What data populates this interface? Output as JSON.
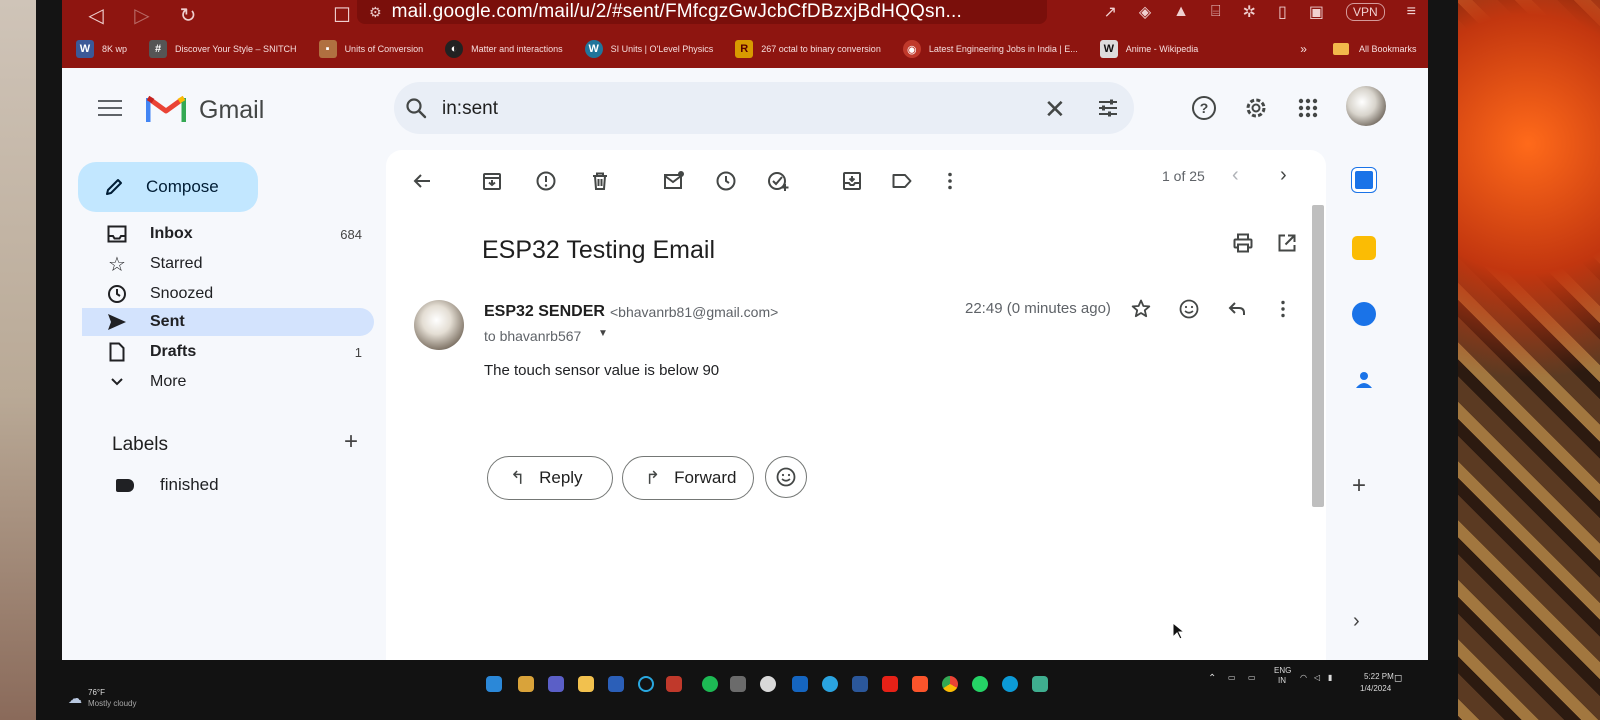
{
  "browser": {
    "url": "mail.google.com/mail/u/2/#sent/FMfcgzGwJcbCfDBzxjBdHQQsn...",
    "vpn_label": "VPN",
    "bookmarks": [
      {
        "icon": "W",
        "label": "8K wp",
        "color": "#3b5998"
      },
      {
        "icon": "#",
        "label": "Discover Your Style – SNITCH",
        "color": "#555555"
      },
      {
        "icon": "▪",
        "label": "Units of Conversion",
        "color": "#b07040"
      },
      {
        "icon": "◐",
        "label": "Matter and interactions",
        "color": "#222222"
      },
      {
        "icon": "W",
        "label": "SI Units | O'Level Physics",
        "color": "#21759b"
      },
      {
        "icon": "R",
        "label": "267 octal to binary conversion",
        "color": "#d89a00"
      },
      {
        "icon": "◉",
        "label": "Latest Engineering Jobs in India | E...",
        "color": "#c0392b"
      },
      {
        "icon": "W",
        "label": "Anime - Wikipedia",
        "color": "#dddddd"
      }
    ],
    "bookmarks_more": "»",
    "all_bookmarks": "All Bookmarks"
  },
  "gmail": {
    "app_name": "Gmail",
    "search_query": "in:sent",
    "compose_label": "Compose",
    "nav": [
      {
        "label": "Inbox",
        "count": "684",
        "bold": true,
        "icon": "inbox-icon"
      },
      {
        "label": "Starred",
        "count": "",
        "bold": false,
        "icon": "star-icon"
      },
      {
        "label": "Snoozed",
        "count": "",
        "bold": false,
        "icon": "snooze-icon"
      },
      {
        "label": "Sent",
        "count": "",
        "bold": true,
        "icon": "send-icon",
        "active": true
      },
      {
        "label": "Drafts",
        "count": "1",
        "bold": true,
        "icon": "draft-icon"
      },
      {
        "label": "More",
        "count": "",
        "bold": false,
        "icon": "chevron-down-icon"
      }
    ],
    "labels_title": "Labels",
    "labels": [
      {
        "label": "finished"
      }
    ],
    "pager": "1 of 25",
    "email": {
      "subject": "ESP32 Testing Email",
      "sender_name": "ESP32 SENDER",
      "sender_email": "<bhavanrb81@gmail.com>",
      "to": "to bhavanrb567",
      "time": "22:49 (0 minutes ago)",
      "body": "The touch sensor value is below 90"
    },
    "reply_label": "Reply",
    "forward_label": "Forward"
  },
  "taskbar": {
    "weather_temp": "76°F",
    "weather_desc": "Mostly cloudy",
    "lang": "ENG",
    "lang_region": "IN",
    "clock_time": "5:22 PM",
    "clock_date": "1/4/2024"
  },
  "colors": {
    "browser_chrome": "#8e1510",
    "compose_bg": "#c2e7ff",
    "active_nav": "#d3e3fd",
    "search_bg": "#e9eef6"
  }
}
